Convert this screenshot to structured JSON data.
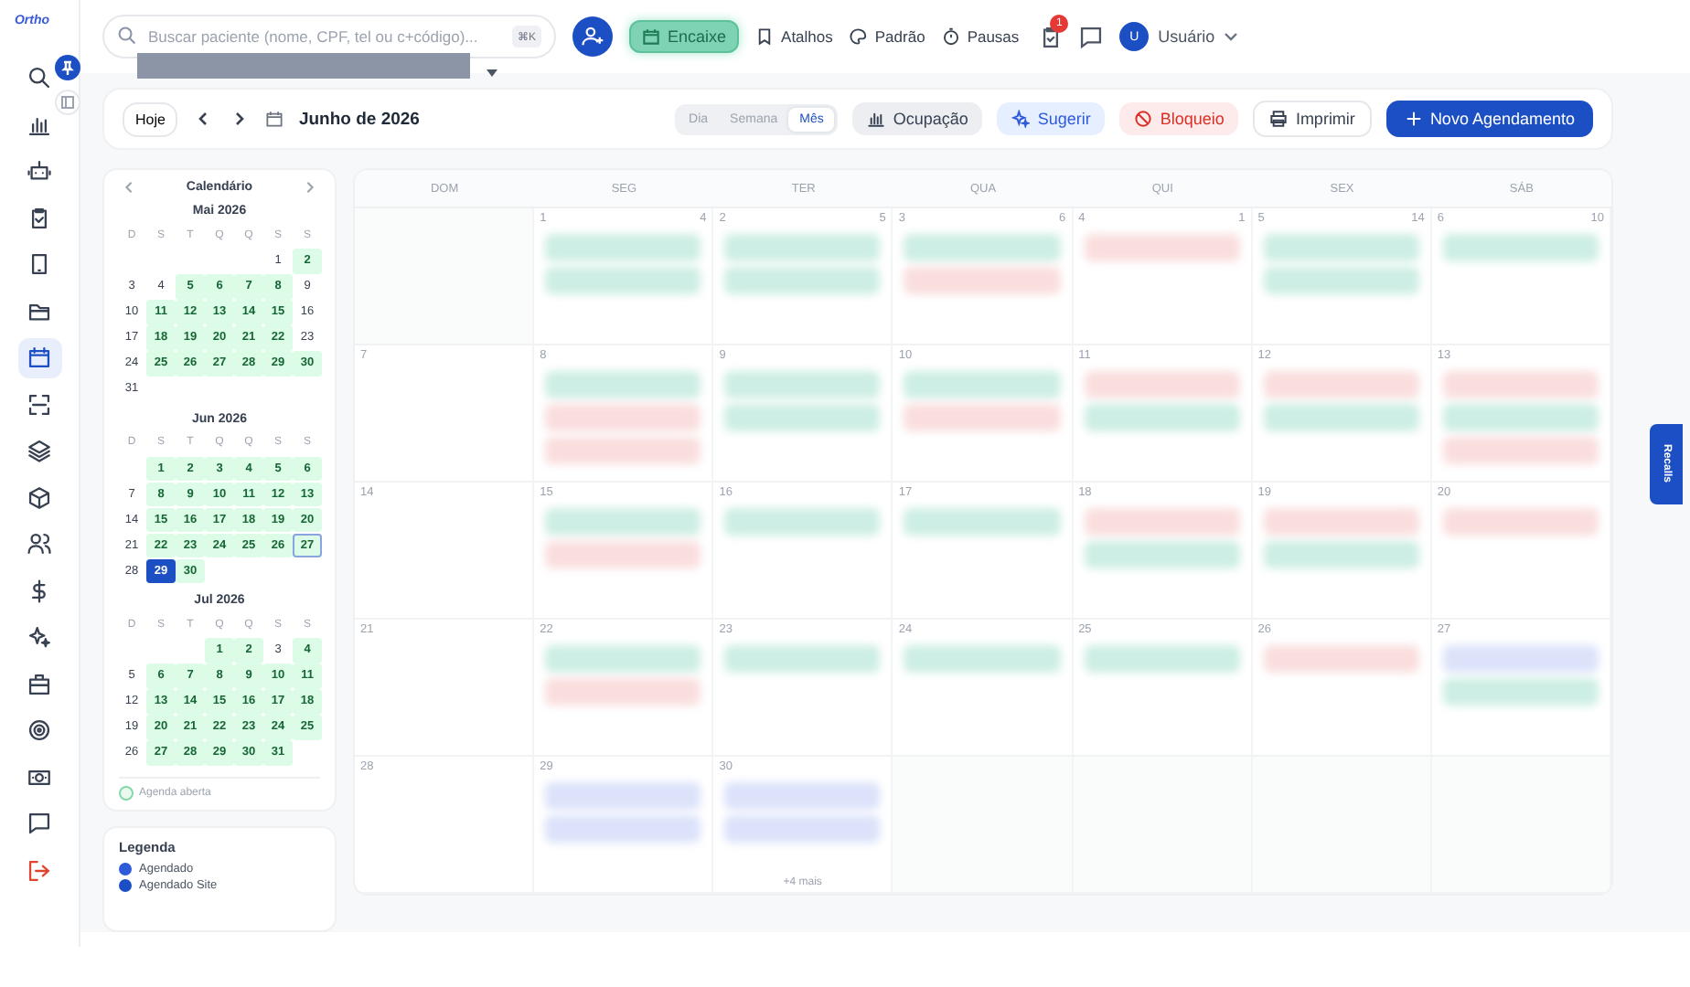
{
  "sidebar": {
    "logo": "Ortho",
    "items": [
      {
        "selected": false
      },
      {
        "selected": false
      },
      {
        "selected": false
      },
      {
        "selected": false
      },
      {
        "selected": false
      },
      {
        "selected": false
      },
      {
        "selected": true
      },
      {
        "selected": false
      },
      {
        "selected": false
      },
      {
        "selected": false
      },
      {
        "selected": false
      },
      {
        "selected": false
      },
      {
        "selected": false
      },
      {
        "selected": false
      },
      {
        "selected": false
      },
      {
        "selected": false
      },
      {
        "selected": false
      },
      {
        "selected": false
      }
    ]
  },
  "topbar": {
    "search": {
      "placeholder": "Buscar paciente (nome, CPF, tel ou c+código)...",
      "shortcut": "⌘K"
    },
    "encaixe": "Encaixe",
    "links": [
      {
        "label": "Atalhos"
      },
      {
        "label": "Padrão"
      },
      {
        "label": "Pausas"
      }
    ],
    "badge": "1",
    "user": {
      "initial": "U",
      "name": "Usuário"
    }
  },
  "toolbar": {
    "today": "Hoje",
    "title": "Junho de 2026",
    "views": [
      {
        "label": "Dia",
        "selected": false
      },
      {
        "label": "Semana",
        "selected": false
      },
      {
        "label": "Mês",
        "selected": true
      }
    ],
    "actions": [
      {
        "kind": "gray",
        "label": "Ocupação"
      },
      {
        "kind": "blue",
        "label": "Sugerir"
      },
      {
        "kind": "red",
        "label": "Bloqueio"
      },
      {
        "kind": "white",
        "label": "Imprimir"
      },
      {
        "kind": "primary",
        "label": "Novo Agendamento"
      }
    ]
  },
  "mini": {
    "title": "Calendário",
    "months": [
      {
        "title": "Mai 2026",
        "weekdays": [
          "D",
          "S",
          "T",
          "Q",
          "Q",
          "S",
          "S"
        ],
        "days": [
          {
            "n": "1",
            "open": false,
            "selected": false,
            "today": false
          },
          {
            "n": "2",
            "open": true,
            "selected": false,
            "today": false
          },
          {
            "n": "3",
            "open": false,
            "selected": false,
            "today": false
          },
          {
            "n": "4",
            "open": false,
            "selected": false,
            "today": false
          },
          {
            "n": "5",
            "open": true,
            "selected": false,
            "today": false
          },
          {
            "n": "6",
            "open": true,
            "selected": false,
            "today": false
          },
          {
            "n": "7",
            "open": true,
            "selected": false,
            "today": false
          },
          {
            "n": "8",
            "open": true,
            "selected": false,
            "today": false
          },
          {
            "n": "9",
            "open": false,
            "selected": false,
            "today": false
          },
          {
            "n": "10",
            "open": false,
            "selected": false,
            "today": false
          },
          {
            "n": "11",
            "open": true,
            "selected": false,
            "today": false
          },
          {
            "n": "12",
            "open": true,
            "selected": false,
            "today": false
          },
          {
            "n": "13",
            "open": true,
            "selected": false,
            "today": false
          },
          {
            "n": "14",
            "open": true,
            "selected": false,
            "today": false
          },
          {
            "n": "15",
            "open": true,
            "selected": false,
            "today": false
          },
          {
            "n": "16",
            "open": false,
            "selected": false,
            "today": false
          },
          {
            "n": "17",
            "open": false,
            "selected": false,
            "today": false
          },
          {
            "n": "18",
            "open": true,
            "selected": false,
            "today": false
          },
          {
            "n": "19",
            "open": true,
            "selected": false,
            "today": false
          },
          {
            "n": "20",
            "open": true,
            "selected": false,
            "today": false
          },
          {
            "n": "21",
            "open": true,
            "selected": false,
            "today": false
          },
          {
            "n": "22",
            "open": true,
            "selected": false,
            "today": false
          },
          {
            "n": "23",
            "open": false,
            "selected": false,
            "today": false
          },
          {
            "n": "24",
            "open": false,
            "selected": false,
            "today": false
          },
          {
            "n": "25",
            "open": true,
            "selected": false,
            "today": false
          },
          {
            "n": "26",
            "open": true,
            "selected": false,
            "today": false
          },
          {
            "n": "27",
            "open": true,
            "selected": false,
            "today": false
          },
          {
            "n": "28",
            "open": true,
            "selected": false,
            "today": false
          },
          {
            "n": "29",
            "open": true,
            "selected": false,
            "today": false
          },
          {
            "n": "30",
            "open": true,
            "selected": false,
            "today": false
          },
          {
            "n": "31",
            "open": false,
            "selected": false,
            "today": false
          }
        ]
      },
      {
        "title": "Jun 2026",
        "weekdays": [
          "D",
          "S",
          "T",
          "Q",
          "Q",
          "S",
          "S"
        ],
        "days": [
          {
            "n": "1",
            "open": true,
            "selected": false,
            "today": false
          },
          {
            "n": "2",
            "open": true,
            "selected": false,
            "today": false
          },
          {
            "n": "3",
            "open": true,
            "selected": false,
            "today": false
          },
          {
            "n": "4",
            "open": true,
            "selected": false,
            "today": false
          },
          {
            "n": "5",
            "open": true,
            "selected": false,
            "today": false
          },
          {
            "n": "6",
            "open": true,
            "selected": false,
            "today": false
          },
          {
            "n": "7",
            "open": false,
            "selected": false,
            "today": false
          },
          {
            "n": "8",
            "open": true,
            "selected": false,
            "today": false
          },
          {
            "n": "9",
            "open": true,
            "selected": false,
            "today": false
          },
          {
            "n": "10",
            "open": true,
            "selected": false,
            "today": false
          },
          {
            "n": "11",
            "open": true,
            "selected": false,
            "today": false
          },
          {
            "n": "12",
            "open": true,
            "selected": false,
            "today": false
          },
          {
            "n": "13",
            "open": true,
            "selected": false,
            "today": false
          },
          {
            "n": "14",
            "open": false,
            "selected": false,
            "today": false
          },
          {
            "n": "15",
            "open": true,
            "selected": false,
            "today": false
          },
          {
            "n": "16",
            "open": true,
            "selected": false,
            "today": false
          },
          {
            "n": "17",
            "open": true,
            "selected": false,
            "today": false
          },
          {
            "n": "18",
            "open": true,
            "selected": false,
            "today": false
          },
          {
            "n": "19",
            "open": true,
            "selected": false,
            "today": false
          },
          {
            "n": "20",
            "open": true,
            "selected": false,
            "today": false
          },
          {
            "n": "21",
            "open": false,
            "selected": false,
            "today": false
          },
          {
            "n": "22",
            "open": true,
            "selected": false,
            "today": false
          },
          {
            "n": "23",
            "open": true,
            "selected": false,
            "today": false
          },
          {
            "n": "24",
            "open": true,
            "selected": false,
            "today": false
          },
          {
            "n": "25",
            "open": true,
            "selected": false,
            "today": false
          },
          {
            "n": "26",
            "open": true,
            "selected": false,
            "today": false
          },
          {
            "n": "27",
            "open": true,
            "selected": false,
            "today": true
          },
          {
            "n": "28",
            "open": false,
            "selected": false,
            "today": false
          },
          {
            "n": "29",
            "open": true,
            "selected": true,
            "today": false
          },
          {
            "n": "30",
            "open": true,
            "selected": false,
            "today": false
          }
        ]
      },
      {
        "title": "Jul 2026",
        "weekdays": [
          "D",
          "S",
          "T",
          "Q",
          "Q",
          "S",
          "S"
        ],
        "days": [
          {
            "n": "1",
            "open": true,
            "selected": false,
            "today": false
          },
          {
            "n": "2",
            "open": true,
            "selected": false,
            "today": false
          },
          {
            "n": "3",
            "open": false,
            "selected": false,
            "today": false
          },
          {
            "n": "4",
            "open": true,
            "selected": false,
            "today": false
          },
          {
            "n": "5",
            "open": false,
            "selected": false,
            "today": false
          },
          {
            "n": "6",
            "open": true,
            "selected": false,
            "today": false
          },
          {
            "n": "7",
            "open": true,
            "selected": false,
            "today": false
          },
          {
            "n": "8",
            "open": true,
            "selected": false,
            "today": false
          },
          {
            "n": "9",
            "open": true,
            "selected": false,
            "today": false
          },
          {
            "n": "10",
            "open": true,
            "selected": false,
            "today": false
          },
          {
            "n": "11",
            "open": true,
            "selected": false,
            "today": false
          },
          {
            "n": "12",
            "open": false,
            "selected": false,
            "today": false
          },
          {
            "n": "13",
            "open": true,
            "selected": false,
            "today": false
          },
          {
            "n": "14",
            "open": true,
            "selected": false,
            "today": false
          },
          {
            "n": "15",
            "open": true,
            "selected": false,
            "today": false
          },
          {
            "n": "16",
            "open": true,
            "selected": false,
            "today": false
          },
          {
            "n": "17",
            "open": true,
            "selected": false,
            "today": false
          },
          {
            "n": "18",
            "open": true,
            "selected": false,
            "today": false
          },
          {
            "n": "19",
            "open": false,
            "selected": false,
            "today": false
          },
          {
            "n": "20",
            "open": true,
            "selected": false,
            "today": false
          },
          {
            "n": "21",
            "open": true,
            "selected": false,
            "today": false
          },
          {
            "n": "22",
            "open": true,
            "selected": false,
            "today": false
          },
          {
            "n": "23",
            "open": true,
            "selected": false,
            "today": false
          },
          {
            "n": "24",
            "open": true,
            "selected": false,
            "today": false
          },
          {
            "n": "25",
            "open": true,
            "selected": false,
            "today": false
          },
          {
            "n": "26",
            "open": false,
            "selected": false,
            "today": false
          },
          {
            "n": "27",
            "open": true,
            "selected": false,
            "today": false
          },
          {
            "n": "28",
            "open": true,
            "selected": false,
            "today": false
          },
          {
            "n": "29",
            "open": true,
            "selected": false,
            "today": false
          },
          {
            "n": "30",
            "open": true,
            "selected": false,
            "today": false
          },
          {
            "n": "31",
            "open": true,
            "selected": false,
            "today": false
          }
        ]
      }
    ],
    "open_legend": "Agenda aberta"
  },
  "legend": {
    "title": "Legenda",
    "items": [
      {
        "label": "Agendado",
        "color": "#2f5bd8"
      },
      {
        "label": "Agendado Site",
        "color": "#1d4fc4"
      }
    ]
  },
  "month": {
    "weekdays": [
      "DOM",
      "SEG",
      "TER",
      "QUA",
      "QUI",
      "SEX",
      "SÁB"
    ],
    "weeks": [
      [
        {
          "kind": "blank"
        },
        {
          "kind": "day",
          "day": "1",
          "count": "4",
          "events": [
            {
              "color": "#cdeee4"
            },
            {
              "color": "#cdeee4"
            }
          ]
        },
        {
          "kind": "day",
          "day": "2",
          "count": "5",
          "events": [
            {
              "color": "#cdeee4"
            },
            {
              "color": "#cdeee4"
            }
          ]
        },
        {
          "kind": "day",
          "day": "3",
          "count": "6",
          "events": [
            {
              "color": "#cdeee4"
            },
            {
              "color": "#fadede"
            }
          ]
        },
        {
          "kind": "day",
          "day": "4",
          "count": "1",
          "events": [
            {
              "color": "#fadede"
            }
          ]
        },
        {
          "kind": "day",
          "day": "5",
          "count": "14",
          "events": [
            {
              "color": "#cdeee4"
            },
            {
              "color": "#cdeee4"
            }
          ]
        },
        {
          "kind": "day",
          "day": "6",
          "count": "10",
          "events": [
            {
              "color": "#cdeee4"
            }
          ]
        }
      ],
      [
        {
          "kind": "day",
          "day": "7"
        },
        {
          "kind": "day",
          "day": "8",
          "events": [
            {
              "color": "#cdeee4"
            },
            {
              "color": "#fadede"
            },
            {
              "color": "#fadede"
            }
          ]
        },
        {
          "kind": "day",
          "day": "9",
          "events": [
            {
              "color": "#cdeee4"
            },
            {
              "color": "#cdeee4"
            }
          ]
        },
        {
          "kind": "day",
          "day": "10",
          "events": [
            {
              "color": "#cdeee4"
            },
            {
              "color": "#fadede"
            }
          ]
        },
        {
          "kind": "day",
          "day": "11",
          "events": [
            {
              "color": "#fadede"
            },
            {
              "color": "#cdeee4"
            }
          ]
        },
        {
          "kind": "day",
          "day": "12",
          "events": [
            {
              "color": "#fadede"
            },
            {
              "color": "#cdeee4"
            }
          ]
        },
        {
          "kind": "day",
          "day": "13",
          "events": [
            {
              "color": "#fadede"
            },
            {
              "color": "#cdeee4"
            },
            {
              "color": "#fadede"
            }
          ]
        }
      ],
      [
        {
          "kind": "day",
          "day": "14"
        },
        {
          "kind": "day",
          "day": "15",
          "events": [
            {
              "color": "#cdeee4"
            },
            {
              "color": "#fadede"
            }
          ]
        },
        {
          "kind": "day",
          "day": "16",
          "events": [
            {
              "color": "#cdeee4"
            }
          ]
        },
        {
          "kind": "day",
          "day": "17",
          "events": [
            {
              "color": "#cdeee4"
            }
          ]
        },
        {
          "kind": "day",
          "day": "18",
          "events": [
            {
              "color": "#fadede"
            },
            {
              "color": "#cdeee4"
            }
          ]
        },
        {
          "kind": "day",
          "day": "19",
          "events": [
            {
              "color": "#fadede"
            },
            {
              "color": "#cdeee4"
            }
          ]
        },
        {
          "kind": "day",
          "day": "20",
          "events": [
            {
              "color": "#fadede"
            }
          ]
        }
      ],
      [
        {
          "kind": "day",
          "day": "21"
        },
        {
          "kind": "day",
          "day": "22",
          "events": [
            {
              "color": "#cdeee4"
            },
            {
              "color": "#fadede"
            }
          ]
        },
        {
          "kind": "day",
          "day": "23",
          "events": [
            {
              "color": "#cdeee4"
            }
          ]
        },
        {
          "kind": "day",
          "day": "24",
          "events": [
            {
              "color": "#cdeee4"
            }
          ]
        },
        {
          "kind": "day",
          "day": "25",
          "events": [
            {
              "color": "#cdeee4"
            }
          ]
        },
        {
          "kind": "day",
          "day": "26",
          "events": [
            {
              "color": "#fadede"
            }
          ]
        },
        {
          "kind": "day",
          "day": "27",
          "events": [
            {
              "color": "#dbe2fa"
            },
            {
              "color": "#cdeee4"
            }
          ]
        }
      ],
      [
        {
          "kind": "day",
          "day": "28"
        },
        {
          "kind": "day",
          "day": "29",
          "events": [
            {
              "color": "#dbe2fa"
            },
            {
              "color": "#dbe2fa"
            }
          ]
        },
        {
          "kind": "day",
          "day": "30",
          "events": [
            {
              "color": "#dbe2fa"
            },
            {
              "color": "#dbe2fa"
            }
          ],
          "more": "+4 mais"
        },
        {
          "kind": "blank"
        },
        {
          "kind": "blank"
        },
        {
          "kind": "blank"
        },
        {
          "kind": "blank"
        }
      ]
    ]
  },
  "recalls": "Recalls"
}
